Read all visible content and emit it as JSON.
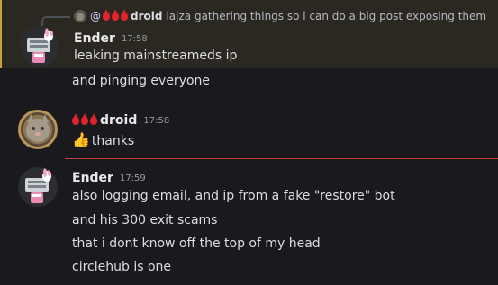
{
  "reply": {
    "mention_prefix": "@",
    "author": "droid",
    "text": "lajza gathering things so i can do a big post exposing them"
  },
  "messages": [
    {
      "author": "Ender",
      "time": "17:58",
      "lines": [
        "leaking mainstreameds ip",
        "and pinging everyone"
      ]
    },
    {
      "author": "droid",
      "time": "17:58",
      "lines": [
        "thanks"
      ]
    },
    {
      "author": "Ender",
      "time": "17:59",
      "lines": [
        "also logging email, and ip from a fake \"restore\" bot",
        "and his 300 exit scams",
        "that i dont know off the top of my head",
        "circlehub is one"
      ]
    }
  ],
  "colors": {
    "highlight_bg": "#2a2820",
    "highlight_border": "#c9a23a",
    "divider": "#c1403d",
    "blood_drop": "#e0242b"
  },
  "icons": {
    "reply_avatar": "cat-avatar-icon",
    "name_decoration": "blood-drop-icon",
    "emoji": "thumbs-up-icon"
  }
}
